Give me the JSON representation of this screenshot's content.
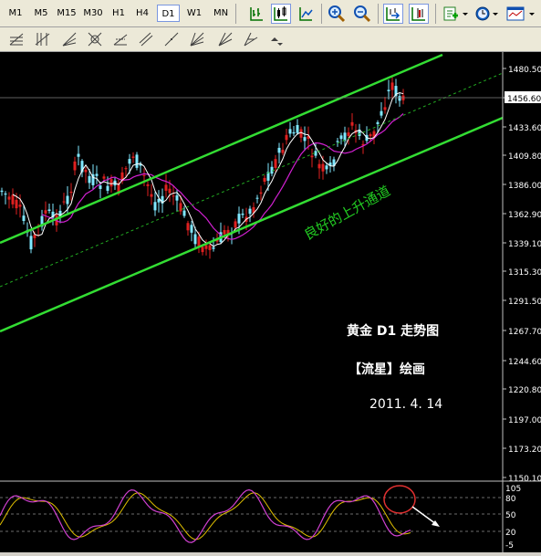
{
  "timeframes": [
    "M1",
    "M5",
    "M15",
    "M30",
    "H1",
    "H4",
    "D1",
    "W1",
    "MN"
  ],
  "active_timeframe": "D1",
  "toolbar_icons": [
    "bar-chart-icon",
    "candlestick-icon",
    "line-chart-icon",
    "zoom-in-icon",
    "zoom-out-icon",
    "autoscroll-icon",
    "chart-shift-icon",
    "indicators-icon",
    "periods-icon",
    "templates-icon"
  ],
  "drawing_tools": [
    "fibo-retracement-icon",
    "fibo-time-zones-icon",
    "fibo-fan-icon",
    "fibo-arcs-icon",
    "fibo-expansion-icon",
    "fibo-channel-icon",
    "gann-line-icon",
    "gann-fan-icon",
    "gann-grid-icon",
    "andrews-pitchfork-icon",
    "arrows-icon"
  ],
  "price_axis": {
    "ticks": [
      "1480.50",
      "1456.60",
      "1433.60",
      "1409.80",
      "1386.00",
      "1362.90",
      "1339.10",
      "1315.30",
      "1291.50",
      "1267.70",
      "1244.60",
      "1220.80",
      "1197.00",
      "1173.20",
      "1150.10"
    ],
    "current_price": "1456.60"
  },
  "annotations": {
    "channel_label": "良好的上升通道",
    "title": "黄金 D1 走势图",
    "author": "【流星】绘画",
    "date": "2011. 4. 14"
  },
  "oscillator": {
    "levels": [
      "105",
      "80",
      "50",
      "20",
      "-5"
    ]
  },
  "colors": {
    "background": "#000000",
    "bull_candle": "#e02020",
    "bear_candle": "#80e8ff",
    "channel": "#33dd33",
    "midline": "#22aa22",
    "ma_fast": "#ffffff",
    "ma_slow": "#d020d0",
    "stoch_main": "#d040d0",
    "stoch_signal": "#e0c000",
    "label_green": "#22cc22"
  }
}
